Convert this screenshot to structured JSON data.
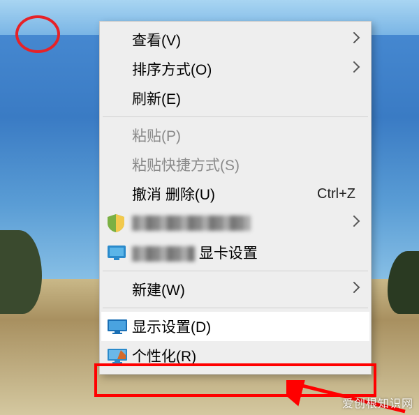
{
  "menu": {
    "view": {
      "label": "查看(V)"
    },
    "sort": {
      "label": "排序方式(O)"
    },
    "refresh": {
      "label": "刷新(E)"
    },
    "paste": {
      "label": "粘贴(P)"
    },
    "paste_shortcut": {
      "label": "粘贴快捷方式(S)"
    },
    "undo": {
      "label": "撤消 删除(U)",
      "shortcut": "Ctrl+Z"
    },
    "vendor1": {
      "label": ""
    },
    "vendor2": {
      "suffix": "显卡设置"
    },
    "new": {
      "label": "新建(W)"
    },
    "display": {
      "label": "显示设置(D)"
    },
    "personalize": {
      "label": "个性化(R)"
    }
  },
  "watermark": "爱创根知识网"
}
